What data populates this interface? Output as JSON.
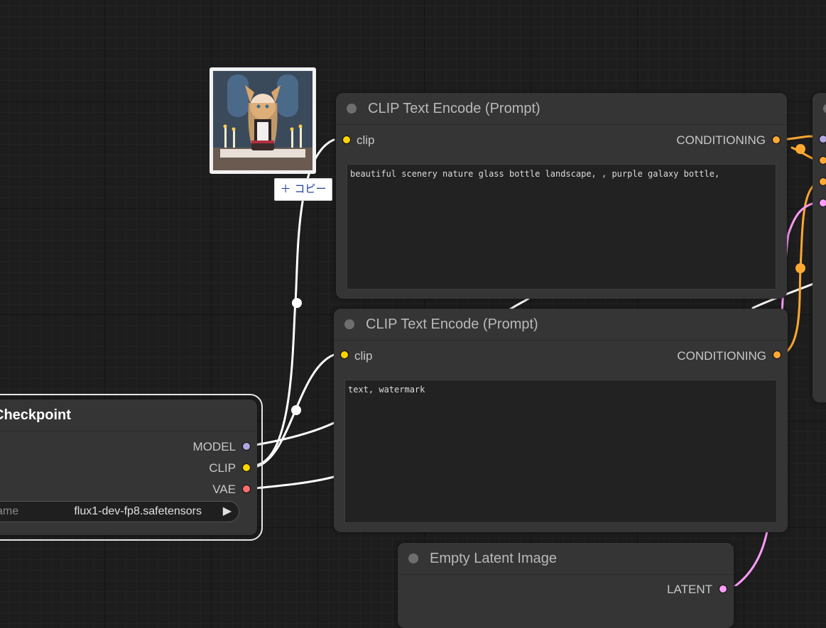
{
  "preview": {
    "copy_button_label": "＋ コピー"
  },
  "clip_node_1": {
    "title": "CLIP Text Encode (Prompt)",
    "input_label": "clip",
    "output_label": "CONDITIONING",
    "text": "beautiful scenery nature glass bottle landscape, , purple galaxy bottle,"
  },
  "clip_node_2": {
    "title": "CLIP Text Encode (Prompt)",
    "input_label": "clip",
    "output_label": "CONDITIONING",
    "text": "text, watermark"
  },
  "checkpoint_node": {
    "title": "Checkpoint",
    "outputs": [
      "MODEL",
      "CLIP",
      "VAE"
    ],
    "ckpt_label": "ame",
    "ckpt_value": "flux1-dev-fp8.safetensors"
  },
  "latent_node": {
    "title": "Empty Latent Image",
    "output_label": "LATENT"
  },
  "colors": {
    "model": "#b2a6e0",
    "clip": "#ffd500",
    "vae": "#ff6e6e",
    "conditioning": "#ffa931",
    "latent": "#ff9cf9"
  }
}
